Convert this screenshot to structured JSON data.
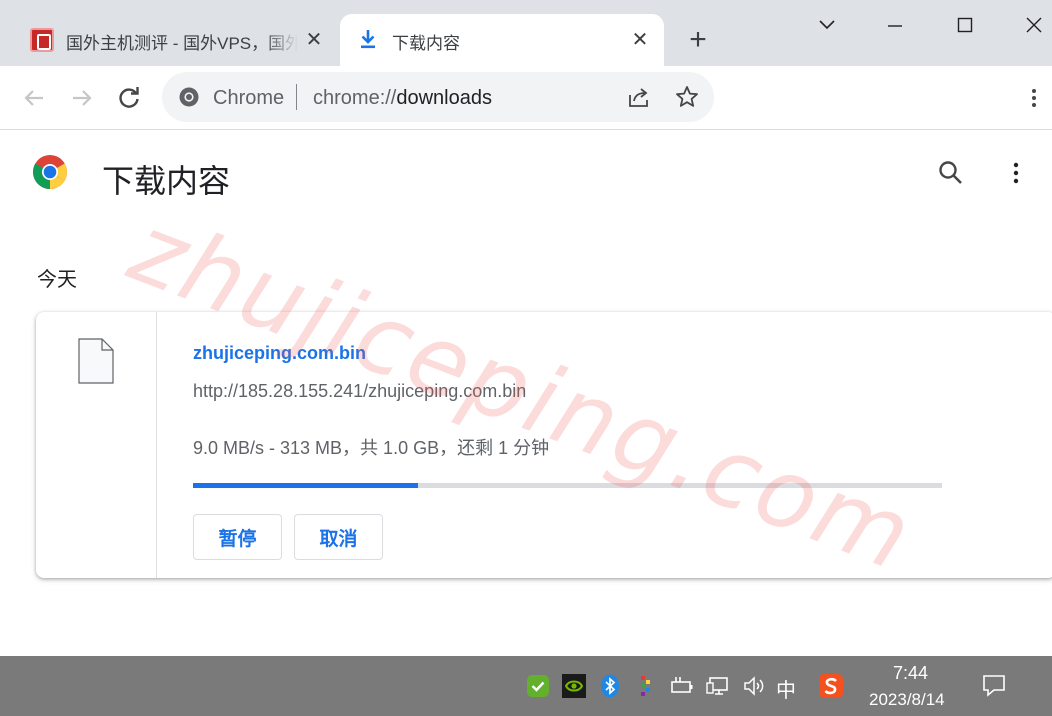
{
  "tabs": [
    {
      "title": "国外主机测评 - 国外VPS，国外",
      "active": false
    },
    {
      "title": "下载内容",
      "active": true
    }
  ],
  "omnibox": {
    "site_label": "Chrome",
    "url_scheme": "chrome://",
    "url_host": "downloads"
  },
  "page": {
    "title": "下载内容",
    "watermark": "zhujiceping.com",
    "date_heading": "今天"
  },
  "download": {
    "file_name": "zhujiceping.com.bin",
    "url": "http://185.28.155.241/zhujiceping.com.bin",
    "status": "9.0 MB/s - 313 MB，共 1.0 GB，还剩 1 分钟",
    "progress_fraction": 0.3,
    "pause_label": "暂停",
    "cancel_label": "取消"
  },
  "taskbar": {
    "ime_label": "中",
    "time": "7:44",
    "date": "2023/8/14"
  },
  "colors": {
    "accent": "#1a73e8",
    "tabstrip": "#dee1e6",
    "taskbar": "#7a7a7a"
  }
}
